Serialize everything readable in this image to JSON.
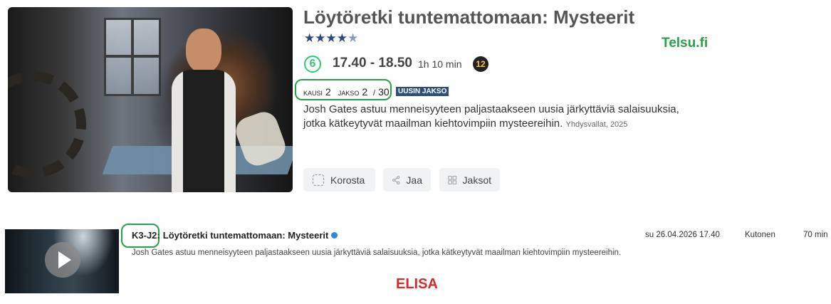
{
  "telsu": {
    "program_title": "Löytöretki tuntemattomaan: Mysteerit",
    "rating_stars": 4.5,
    "channel_number": "6",
    "time_range": "17.40 - 18.50",
    "duration": "1h 10 min",
    "age_rating": "12",
    "season_label": "KAUSI",
    "season_value": "2",
    "episode_label": "JAKSO",
    "episode_value": "2",
    "episode_separator": "/",
    "episode_total": "30",
    "new_badge": "UUSIN JAKSO",
    "description": "Josh Gates astuu menneisyyteen paljastaakseen uusia järkyttäviä salaisuuksia, jotka kätkeytyvät maailman kiehtovimpiin mysteereihin.",
    "meta": "Yhdysvallat, 2025",
    "buttons": {
      "highlight": "Korosta",
      "share": "Jaa",
      "episodes": "Jaksot"
    },
    "label": "Telsu.fi"
  },
  "elisa": {
    "episode_code": "K3-J2:",
    "title": "Löytöretki tuntemattomaan: Mysteerit",
    "description": "Josh Gates astuu menneisyyteen paljastaakseen uusia järkyttäviä salaisuuksia, jotka kätkeytyvät maailman kiehtovimpiin mysteereihin.",
    "date": "su 26.04.2026 17.40",
    "channel": "Kutonen",
    "length": "70 min",
    "label": "ELISA"
  },
  "colors": {
    "highlight_green": "#2aa048",
    "elisa_red": "#d42a2a",
    "badge_blue": "#2f4f7a",
    "star_blue": "#2b4a7a"
  }
}
